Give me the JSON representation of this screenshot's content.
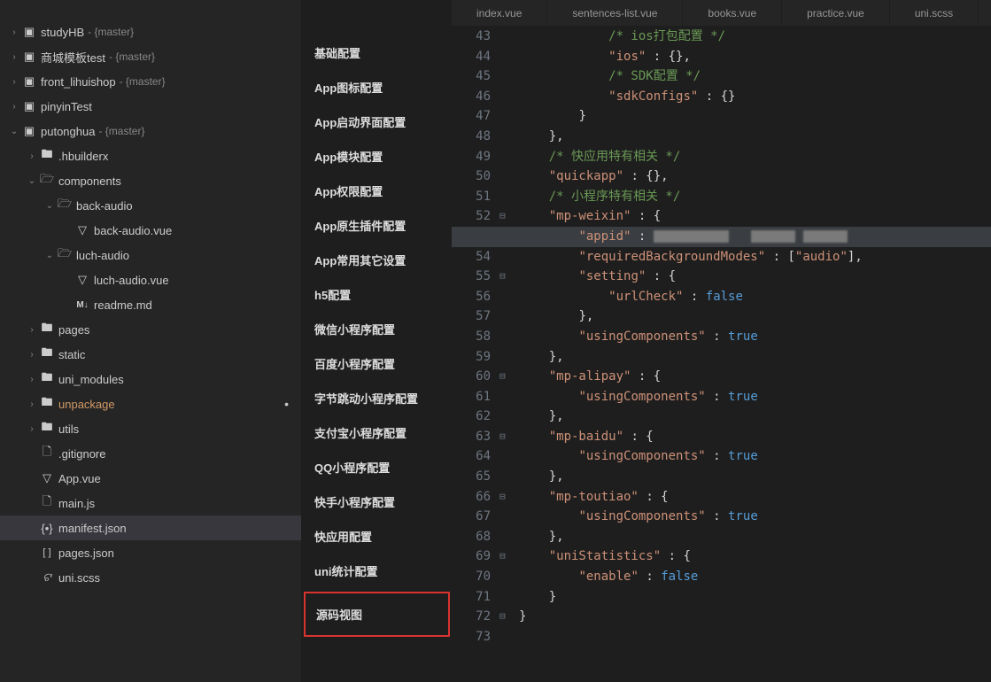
{
  "tree": {
    "projects": [
      {
        "name": "studyHB",
        "branch": "{master}",
        "expanded": false
      },
      {
        "name": "商城模板test",
        "branch": "{master}",
        "expanded": false
      },
      {
        "name": "front_lihuishop",
        "branch": "{master}",
        "expanded": false
      },
      {
        "name": "pinyinTest",
        "branch": "",
        "expanded": false
      },
      {
        "name": "putonghua",
        "branch": "{master}",
        "expanded": true
      }
    ],
    "putonghua_children": {
      "hbuilderx": ".hbuilderx",
      "components": "components",
      "back_audio_dir": "back-audio",
      "back_audio_vue": "back-audio.vue",
      "luch_audio_dir": "luch-audio",
      "luch_audio_vue": "luch-audio.vue",
      "readme_md": "readme.md",
      "pages": "pages",
      "static": "static",
      "uni_modules": "uni_modules",
      "unpackage": "unpackage",
      "utils": "utils",
      "gitignore": ".gitignore",
      "app_vue": "App.vue",
      "main_js": "main.js",
      "manifest_json": "manifest.json",
      "pages_json": "pages.json",
      "uni_scss": "uni.scss"
    }
  },
  "config": {
    "items": [
      "基础配置",
      "App图标配置",
      "App启动界面配置",
      "App模块配置",
      "App权限配置",
      "App原生插件配置",
      "App常用其它设置",
      "h5配置",
      "微信小程序配置",
      "百度小程序配置",
      "字节跳动小程序配置",
      "支付宝小程序配置",
      "QQ小程序配置",
      "快手小程序配置",
      "快应用配置",
      "uni统计配置",
      "源码视图"
    ]
  },
  "tabs": [
    "index.vue",
    "sentences-list.vue",
    "books.vue",
    "practice.vue",
    "uni.scss"
  ],
  "code": {
    "start": 43,
    "lines": [
      {
        "n": 43,
        "t": "            /* ios打包配置 */",
        "cls": "cm"
      },
      {
        "n": 44,
        "html": "            <span class='str'>\"ios\"</span> <span class='p'>: {},</span>"
      },
      {
        "n": 45,
        "t": "            /* SDK配置 */",
        "cls": "cm"
      },
      {
        "n": 46,
        "html": "            <span class='str'>\"sdkConfigs\"</span> <span class='p'>: {}</span>"
      },
      {
        "n": 47,
        "html": "        <span class='p'>}</span>"
      },
      {
        "n": 48,
        "html": "    <span class='p'>},</span>"
      },
      {
        "n": 49,
        "t": "    /* 快应用特有相关 */",
        "cls": "cm"
      },
      {
        "n": 50,
        "html": "    <span class='str'>\"quickapp\"</span> <span class='p'>: {},</span>"
      },
      {
        "n": 51,
        "t": "    /* 小程序特有相关 */",
        "cls": "cm"
      },
      {
        "n": 52,
        "fold": "⊟",
        "html": "    <span class='str'>\"mp-weixin\"</span> <span class='p'>: {</span>"
      },
      {
        "n": 53,
        "hl": true,
        "html": "        <span class='str'>\"appid\"</span> <span class='p'>:</span> <span class='blurred' style='width:85px'></span>   <span class='blurred' style='width:50px'></span> <span class='blurred' style='width:50px'></span>"
      },
      {
        "n": 54,
        "html": "        <span class='str'>\"requiredBackgroundModes\"</span> <span class='p'>: [</span><span class='str'>\"audio\"</span><span class='p'>],</span>"
      },
      {
        "n": 55,
        "fold": "⊟",
        "html": "        <span class='str'>\"setting\"</span> <span class='p'>: {</span>"
      },
      {
        "n": 56,
        "html": "            <span class='str'>\"urlCheck\"</span> <span class='p'>:</span> <span class='kw'>false</span>"
      },
      {
        "n": 57,
        "html": "        <span class='p'>},</span>"
      },
      {
        "n": 58,
        "html": "        <span class='str'>\"usingComponents\"</span> <span class='p'>:</span> <span class='kw'>true</span>"
      },
      {
        "n": 59,
        "html": "    <span class='p'>},</span>"
      },
      {
        "n": 60,
        "fold": "⊟",
        "html": "    <span class='str'>\"mp-alipay\"</span> <span class='p'>: {</span>"
      },
      {
        "n": 61,
        "html": "        <span class='str'>\"usingComponents\"</span> <span class='p'>:</span> <span class='kw'>true</span>"
      },
      {
        "n": 62,
        "html": "    <span class='p'>},</span>"
      },
      {
        "n": 63,
        "fold": "⊟",
        "html": "    <span class='str'>\"mp-baidu\"</span> <span class='p'>: {</span>"
      },
      {
        "n": 64,
        "html": "        <span class='str'>\"usingComponents\"</span> <span class='p'>:</span> <span class='kw'>true</span>"
      },
      {
        "n": 65,
        "html": "    <span class='p'>},</span>"
      },
      {
        "n": 66,
        "fold": "⊟",
        "html": "    <span class='str'>\"mp-toutiao\"</span> <span class='p'>: {</span>"
      },
      {
        "n": 67,
        "html": "        <span class='str'>\"usingComponents\"</span> <span class='p'>:</span> <span class='kw'>true</span>"
      },
      {
        "n": 68,
        "html": "    <span class='p'>},</span>"
      },
      {
        "n": 69,
        "fold": "⊟",
        "html": "    <span class='str'>\"uniStatistics\"</span> <span class='p'>: {</span>"
      },
      {
        "n": 70,
        "html": "        <span class='str'>\"enable\"</span> <span class='p'>:</span> <span class='kw'>false</span>"
      },
      {
        "n": 71,
        "html": "    <span class='p'>}</span>"
      },
      {
        "n": 72,
        "fold": "⊟",
        "html": "<span class='p'>}</span>"
      },
      {
        "n": 73,
        "html": ""
      }
    ]
  }
}
